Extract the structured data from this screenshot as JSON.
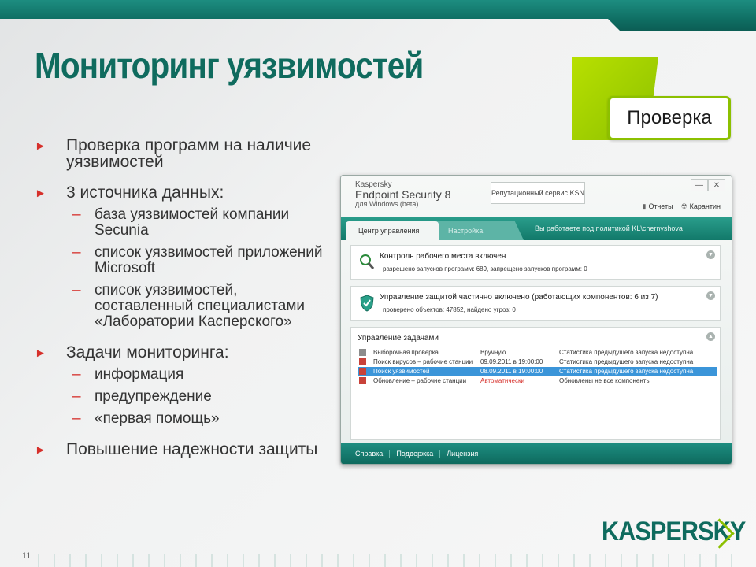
{
  "slide": {
    "title": "Мониторинг уязвимостей",
    "badge": "Проверка",
    "page_number": "11",
    "logo": "KASPERSKY"
  },
  "bullets": [
    {
      "text": "Проверка программ на наличие уязвимостей"
    },
    {
      "text": "3 источника данных:",
      "subs": [
        "база уязвимостей компании Secunia",
        "список уязвимостей приложений Microsoft",
        "список уязвимостей, составленный специалистами «Лаборатории Касперского»"
      ]
    },
    {
      "text": "Задачи мониторинга:",
      "subs": [
        "информация",
        "предупреждение",
        "«первая помощь»"
      ]
    },
    {
      "text": "Повышение надежности защиты"
    }
  ],
  "app": {
    "title_line1": "Kaspersky",
    "title_line2": "Endpoint Security 8",
    "title_line3": "для Windows (beta)",
    "ksn_button": "Репутационный сервис KSN",
    "reports_link": "Отчеты",
    "quarantine_link": "Карантин",
    "tab_control": "Центр управления",
    "tab_settings": "Настройка",
    "policy_text": "Вы работаете под политикой  KL\\chernyshova",
    "panel1_title": "Контроль рабочего места включен",
    "panel1_sub": "разрешено запусков программ: 689, запрещено запусков программ: 0",
    "panel2_title": "Управление защитой частично включено (работающих компонентов: 6 из 7)",
    "panel2_sub": "проверено объектов: 47852, найдено угроз: 0",
    "tasks_title": "Управление задачами",
    "tasks": [
      {
        "name": "Выборочная проверка",
        "schedule": "Вручную",
        "status": "Статистика предыдущего запуска недоступна"
      },
      {
        "name": "Поиск вирусов – рабочие станции",
        "schedule": "09.09.2011 в 19:00:00",
        "status": "Статистика предыдущего запуска недоступна"
      },
      {
        "name": "Поиск уязвимостей",
        "schedule": "08.09.2011 в 19:00:00",
        "status": "Статистика предыдущего запуска недоступна"
      },
      {
        "name": "Обновление – рабочие станции",
        "schedule": "Автоматически",
        "status": "Обновлены не все компоненты"
      }
    ],
    "footer_help": "Справка",
    "footer_support": "Поддержка",
    "footer_license": "Лицензия",
    "colors": {
      "accent": "#0f6b5e",
      "lime": "#8cc000",
      "selection": "#3b95d9",
      "bullet": "#d6302b"
    }
  }
}
